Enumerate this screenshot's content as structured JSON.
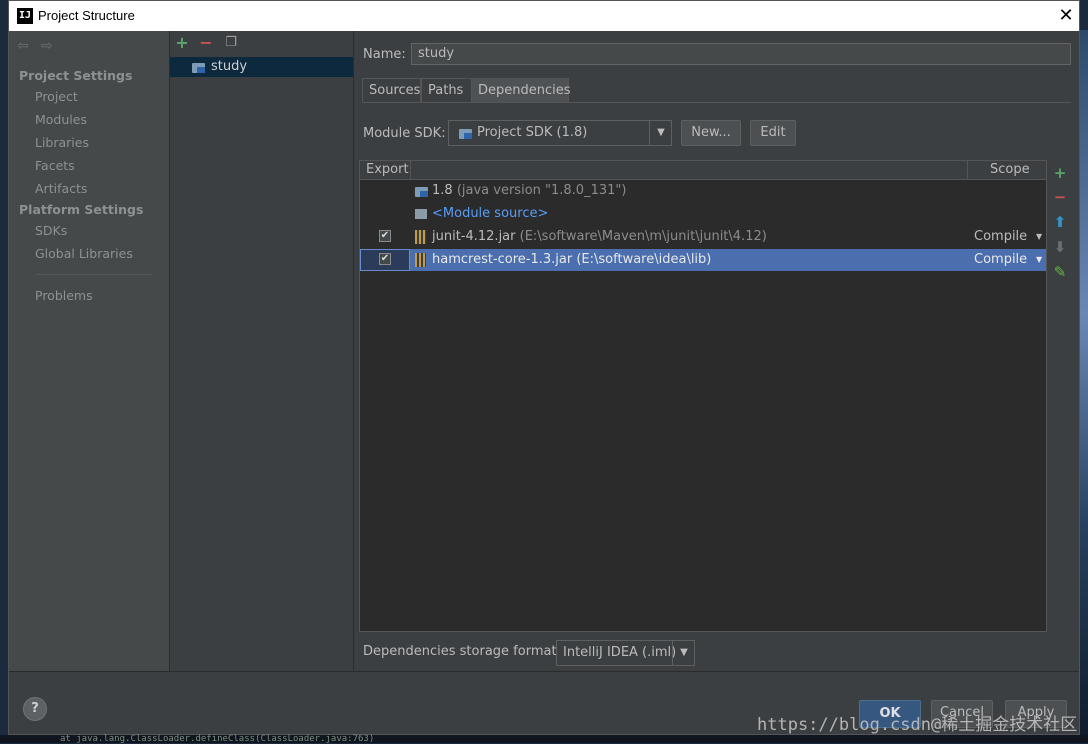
{
  "window": {
    "title": "Project Structure",
    "app_icon": "IJ"
  },
  "nav": {
    "sections": [
      {
        "title": "Project Settings",
        "items": [
          "Project",
          "Modules",
          "Libraries",
          "Facets",
          "Artifacts"
        ]
      },
      {
        "title": "Platform Settings",
        "items": [
          "SDKs",
          "Global Libraries"
        ]
      }
    ],
    "extra_items": [
      "Problems"
    ]
  },
  "tree": {
    "items": [
      {
        "label": "study",
        "selected": true
      }
    ]
  },
  "main": {
    "name_label": "Name:",
    "name_value": "study",
    "tabs": [
      {
        "label": "Sources",
        "active": false
      },
      {
        "label": "Paths",
        "active": false
      },
      {
        "label": "Dependencies",
        "active": true
      }
    ],
    "sdk_label": "Module SDK:",
    "sdk_value": "Project SDK (1.8)",
    "new_button": "New...",
    "edit_button": "Edit",
    "table": {
      "headers": {
        "export": "Export",
        "scope": "Scope"
      },
      "rows": [
        {
          "name": "1.8",
          "detail": "(java version \"1.8.0_131\")",
          "checked": null,
          "scope": "",
          "kind": "jdk"
        },
        {
          "name": "<Module source>",
          "detail": "",
          "checked": null,
          "scope": "",
          "kind": "source"
        },
        {
          "name": "junit-4.12.jar",
          "detail": "(E:\\software\\Maven\\m\\junit\\junit\\4.12)",
          "checked": true,
          "scope": "Compile",
          "kind": "jar"
        },
        {
          "name": "hamcrest-core-1.3.jar",
          "detail": "(E:\\software\\idea\\lib)",
          "checked": true,
          "scope": "Compile",
          "kind": "jar",
          "selected": true
        }
      ]
    },
    "storage_label": "Dependencies storage format:",
    "storage_value": "IntelliJ IDEA (.iml)"
  },
  "buttons": {
    "help": "?",
    "ok": "OK",
    "cancel": "Cancel",
    "apply": "Apply"
  },
  "watermark": "https://blog.csdn@稀土掘金技术社区",
  "console_text": "at java.lang.ClassLoader.defineClass(ClassLoader.java:763)",
  "colors": {
    "accent": "#4b6eaf",
    "add": "#59a869",
    "remove": "#c75450",
    "up": "#3592c4",
    "edit": "#62b543"
  }
}
